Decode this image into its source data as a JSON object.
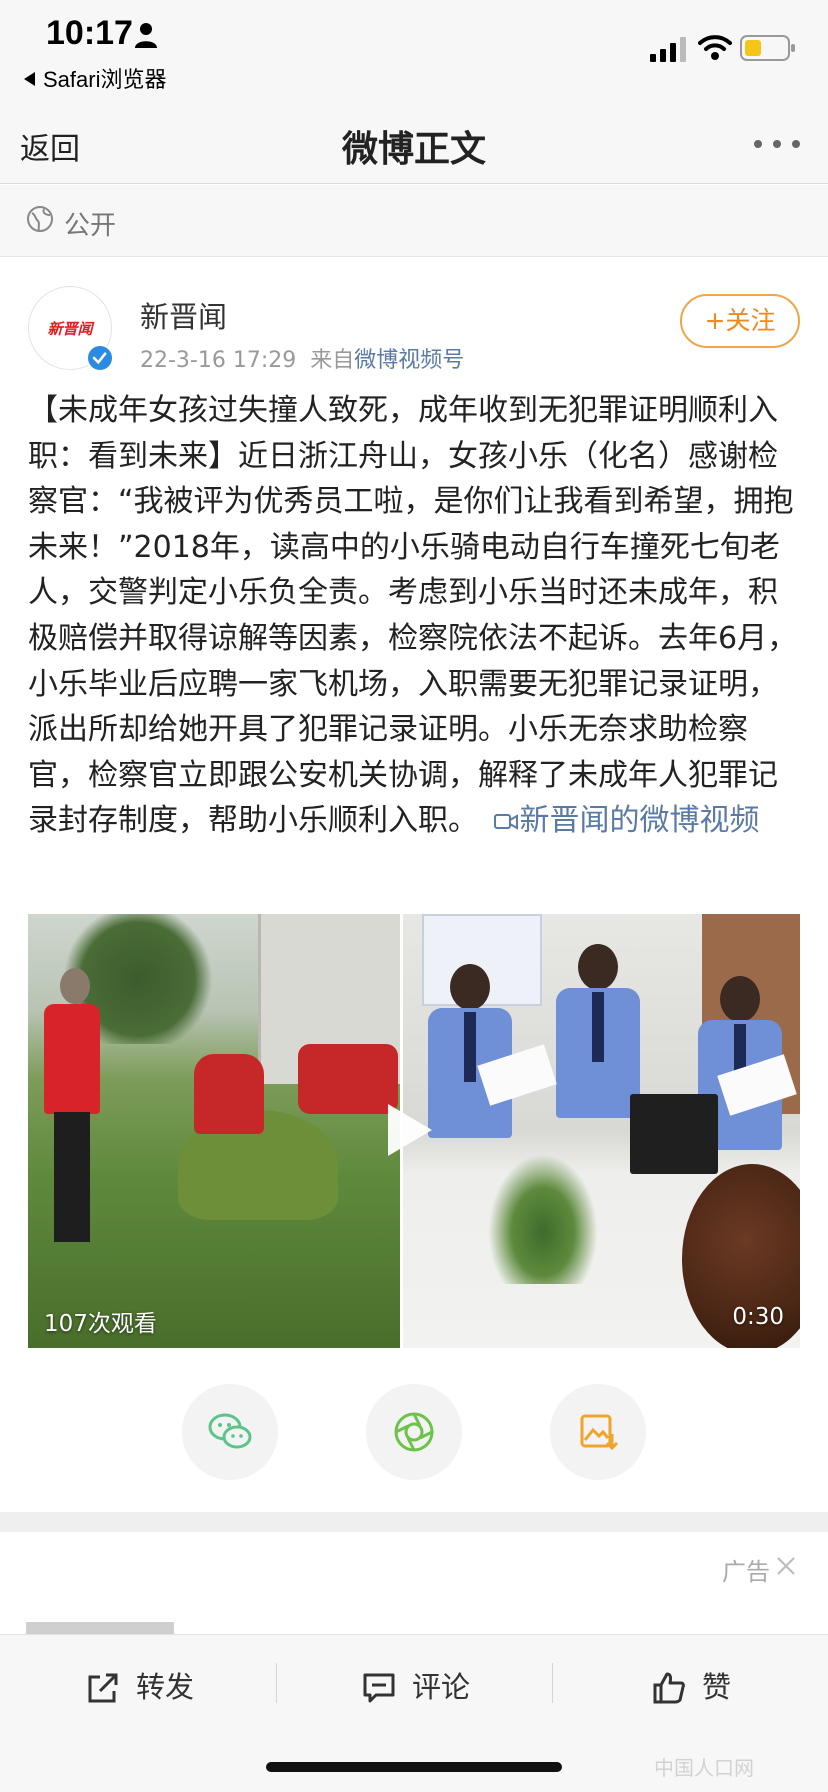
{
  "status_bar": {
    "time": "10:17",
    "back_app": "Safari浏览器"
  },
  "nav": {
    "back": "返回",
    "title": "微博正文"
  },
  "visibility": {
    "label": "公开"
  },
  "post": {
    "avatar_text": "新晋闻",
    "author": "新晋闻",
    "date": "22-3-16 17:29",
    "source_prefix": "来自",
    "source": "微博视频号",
    "follow_label": "+关注",
    "body": "【未成年女孩过失撞人致死，成年收到无犯罪证明顺利入职：看到未来】近日浙江舟山，女孩小乐（化名）感谢检察官：“我被评为优秀员工啦，是你们让我看到希望，拥抱未来！”2018年，读高中的小乐骑电动自行车撞死七旬老人，交警判定小乐负全责。考虑到小乐当时还未成年，积极赔偿并取得谅解等因素，检察院依法不起诉。去年6月，小乐毕业后应聘一家飞机场，入职需要无犯罪记录证明，派出所却给她开具了犯罪记录证明。小乐无奈求助检察官，检察官立即跟公安机关协调，解释了未成年人犯罪记录封存制度，帮助小乐顺利入职。",
    "video_link": "新晋闻的微博视频"
  },
  "video": {
    "views": "107次观看",
    "duration": "0:30"
  },
  "ad": {
    "label": "广告"
  },
  "actions": {
    "repost": "转发",
    "comment": "评论",
    "like": "赞"
  },
  "watermark": "中国人口网",
  "colors": {
    "link": "#5b7aa6",
    "follow": "#f08a1a",
    "wechat": "#5cc38a",
    "moments": "#6cc24a",
    "save": "#f0a52a"
  }
}
